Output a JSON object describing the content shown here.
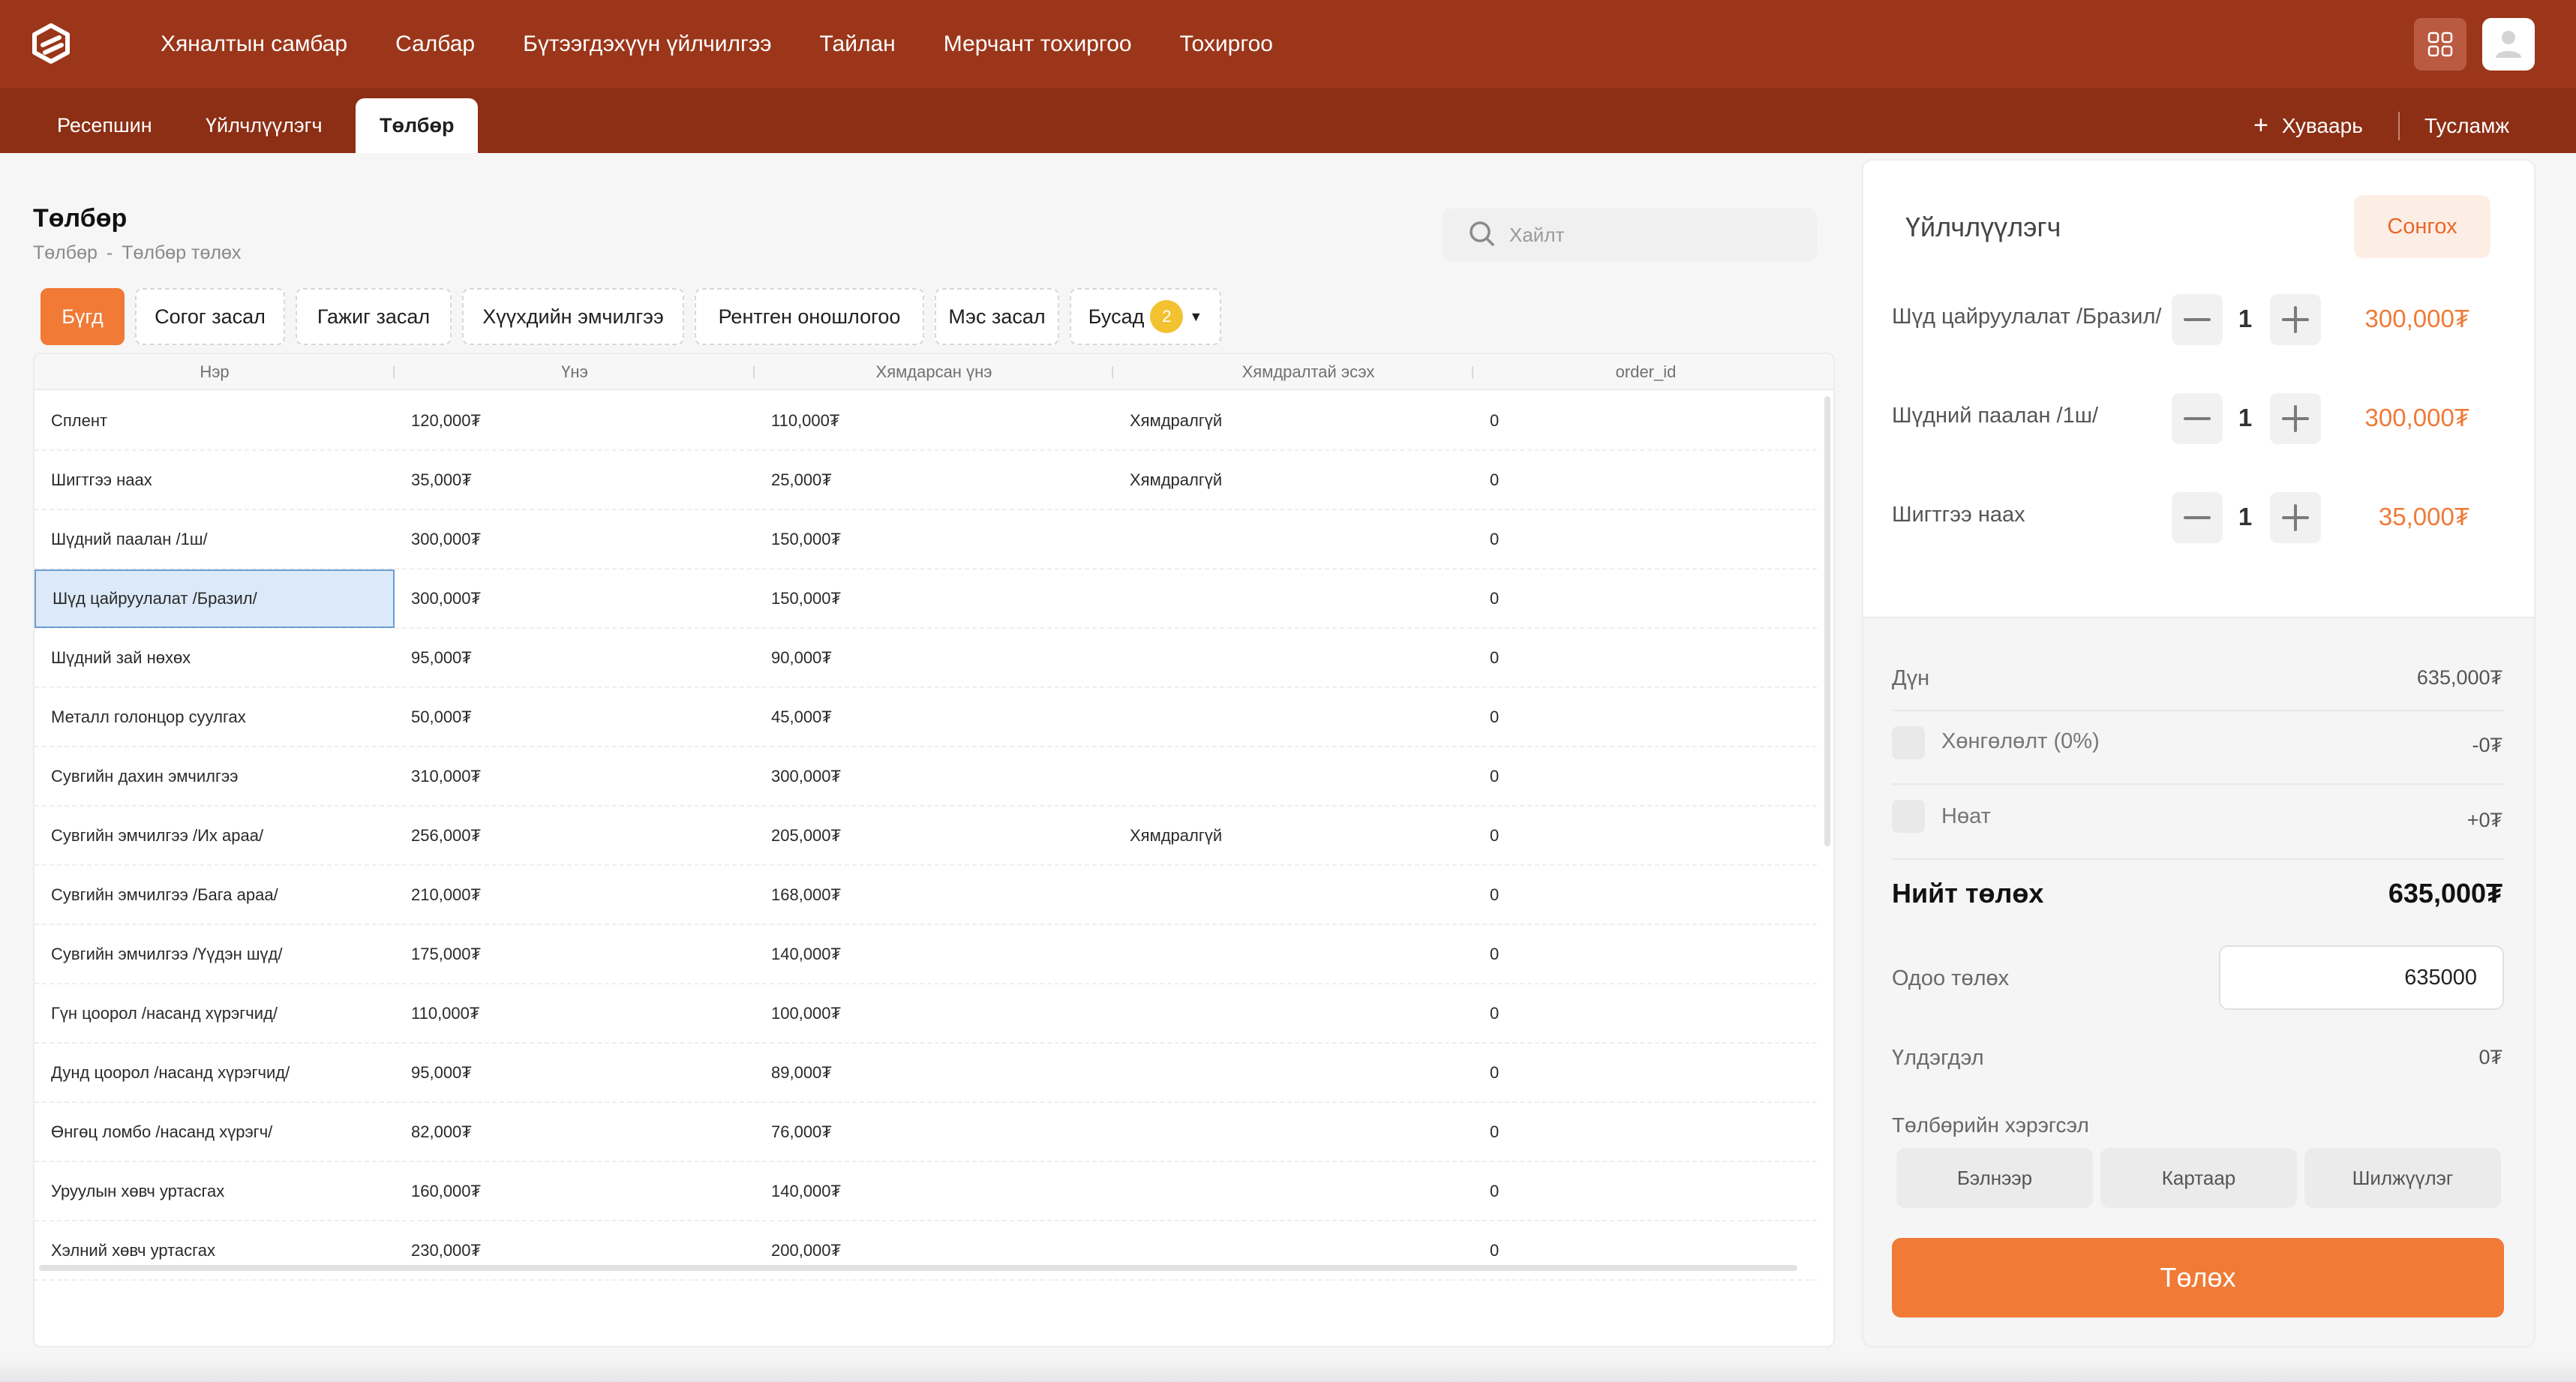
{
  "nav": {
    "items": [
      "Хяналтын самбар",
      "Салбар",
      "Бүтээгдэхүүн үйлчилгээ",
      "Тайлан",
      "Мерчант тохиргоо",
      "Тохиргоо"
    ]
  },
  "subnav": {
    "tabs": [
      "Ресепшин",
      "Үйлчлүүлэгч",
      "Төлбөр"
    ],
    "active_tab": "Төлбөр",
    "schedule_label": "Хуваарь",
    "help_label": "Тусламж"
  },
  "page": {
    "title": "Төлбөр",
    "breadcrumb": [
      "Төлбөр",
      "Төлбөр төлөх"
    ],
    "breadcrumb_sep": "-",
    "search_placeholder": "Хайлт"
  },
  "filters": {
    "chips": [
      "Бүгд",
      "Согог засал",
      "Гажиг засал",
      "Хүүхдийн эмчилгээ",
      "Рентген оношлогоо",
      "Мэс засал"
    ],
    "more_label": "Бусад",
    "more_count": "2"
  },
  "table": {
    "headers": [
      "Нэр",
      "Үнэ",
      "Хямдарсан үнэ",
      "Хямдралтай эсэх",
      "order_id"
    ],
    "rows": [
      [
        "Сплент",
        "120,000₮",
        "110,000₮",
        "Хямдралгүй",
        "0"
      ],
      [
        "Шигтгээ наах",
        "35,000₮",
        "25,000₮",
        "Хямдралгүй",
        "0"
      ],
      [
        "Шүдний паалан /1ш/",
        "300,000₮",
        "150,000₮",
        "",
        "0"
      ],
      [
        "Шүд цайруулалат /Бразил/",
        "300,000₮",
        "150,000₮",
        "",
        "0"
      ],
      [
        "Шүдний зай нөхөх",
        "95,000₮",
        "90,000₮",
        "",
        "0"
      ],
      [
        "Металл голонцор суулгах",
        "50,000₮",
        "45,000₮",
        "",
        "0"
      ],
      [
        "Сувгийн дахин эмчилгээ",
        "310,000₮",
        "300,000₮",
        "",
        "0"
      ],
      [
        "Сувгийн эмчилгээ /Их араа/",
        "256,000₮",
        "205,000₮",
        "Хямдралгүй",
        "0"
      ],
      [
        "Сувгийн эмчилгээ /Бага араа/",
        "210,000₮",
        "168,000₮",
        "",
        "0"
      ],
      [
        "Сувгийн эмчилгээ /Үүдэн шүд/",
        "175,000₮",
        "140,000₮",
        "",
        "0"
      ],
      [
        "Гүн цоорол /насанд хүрэгчид/",
        "110,000₮",
        "100,000₮",
        "",
        "0"
      ],
      [
        "Дунд цоорол /насанд хүрэгчид/",
        "95,000₮",
        "89,000₮",
        "",
        "0"
      ],
      [
        "Өнгөц ломбо /насанд хүрэгч/",
        "82,000₮",
        "76,000₮",
        "",
        "0"
      ],
      [
        "Уруулын хөвч уртасгах",
        "160,000₮",
        "140,000₮",
        "",
        "0"
      ],
      [
        "Хэлний хөвч уртасгах",
        "230,000₮",
        "200,000₮",
        "",
        "0"
      ]
    ],
    "selected_row": 3
  },
  "cart": {
    "title": "Үйлчлүүлэгч",
    "select_label": "Сонгох",
    "items": [
      {
        "name": "Шүд цайруулалат /Бразил/",
        "qty": "1",
        "price": "300,000₮"
      },
      {
        "name": "Шүдний паалан /1ш/",
        "qty": "1",
        "price": "300,000₮"
      },
      {
        "name": "Шигтгээ наах",
        "qty": "1",
        "price": "35,000₮"
      }
    ]
  },
  "summary": {
    "subtotal_label": "Дүн",
    "subtotal_value": "635,000₮",
    "discount_label": "Хөнгөлөлт (0%)",
    "discount_value": "-0₮",
    "vat_label": "Нөат",
    "vat_value": "+0₮",
    "total_label": "Нийт төлөх",
    "total_value": "635,000₮",
    "pay_now_label": "Одоо төлөх",
    "pay_now_value": "635000",
    "change_label": "Үлдэгдэл",
    "change_value": "0₮",
    "method_title": "Төлбөрийн хэрэгсэл",
    "methods": [
      "Бэлнээр",
      "Картаар",
      "Шилжүүлэг"
    ],
    "pay_button": "Төлөх"
  },
  "colors": {
    "topbar": "#9b361a",
    "subbar": "#8c2f15",
    "accent": "#f07a36",
    "badge": "#f2c230",
    "selected_cell": "#dbe9f8"
  },
  "icons": [
    "logo-icon",
    "apps-grid-icon",
    "user-icon",
    "plus-icon",
    "search-icon",
    "minus-icon",
    "chevron-down-icon"
  ]
}
